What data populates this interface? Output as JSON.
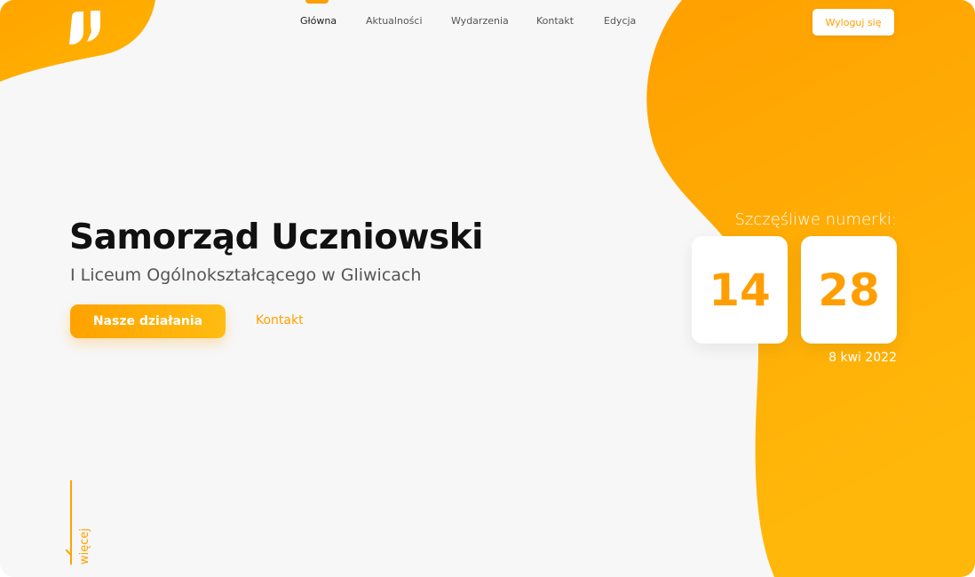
{
  "nav": {
    "items": [
      {
        "label": "Główna",
        "active": true
      },
      {
        "label": "Aktualności",
        "active": false
      },
      {
        "label": "Wydarzenia",
        "active": false
      },
      {
        "label": "Kontakt",
        "active": false
      },
      {
        "label": "Edycja",
        "active": false
      }
    ],
    "logout_label": "Wyloguj się"
  },
  "hero": {
    "title": "Samorząd Uczniowski",
    "subtitle": "I Liceum Ogólnokształcącego w Gliwicach",
    "primary_button": "Nasze działania",
    "secondary_link": "Kontakt"
  },
  "lucky_numbers": {
    "label": "Szczęśliwe numerki:",
    "numbers": [
      "14",
      "28"
    ],
    "date": "8 kwi 2022"
  },
  "scroll_hint": {
    "label": "więcej"
  },
  "colors": {
    "accent": "#ff9e00",
    "accent_light": "#ffbc12",
    "background": "#f7f7f7",
    "title": "#111111",
    "subtitle": "#555555"
  },
  "icons": {
    "logo": "su-logo-icon",
    "scroll": "arrow-down-icon"
  }
}
